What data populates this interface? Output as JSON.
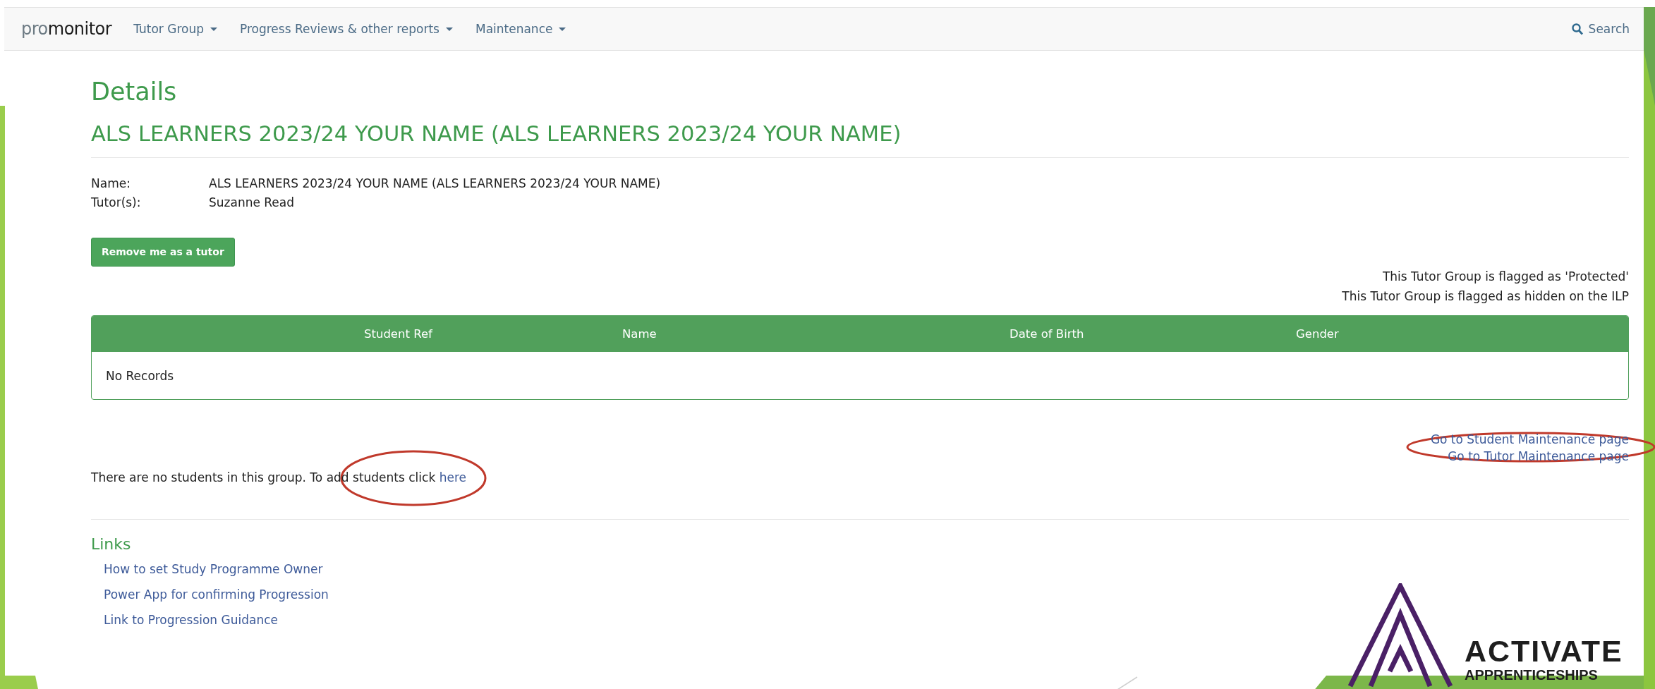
{
  "nav": {
    "brand": [
      "pro",
      "monitor"
    ],
    "menus": [
      "Tutor Group",
      "Progress Reviews & other reports",
      "Maintenance"
    ],
    "search": "Search"
  },
  "page": {
    "title": "Details",
    "subtitle": "ALS LEARNERS 2023/24 YOUR NAME (ALS LEARNERS 2023/24 YOUR NAME)",
    "fields": [
      {
        "label": "Name:",
        "value": "ALS LEARNERS 2023/24 YOUR NAME (ALS LEARNERS 2023/24 YOUR NAME)"
      },
      {
        "label": "Tutor(s):",
        "value": "Suzanne Read"
      }
    ],
    "action_button": "Remove me as a tutor",
    "flags": [
      "This Tutor Group is flagged as 'Protected'",
      "This Tutor Group is flagged as hidden on the ILP"
    ]
  },
  "table": {
    "columns": [
      "Student Ref",
      "Name",
      "Date of Birth",
      "Gender"
    ],
    "empty_message": "No Records"
  },
  "maintenance_links": [
    "Go to Student Maintenance page",
    "Go to Tutor Maintenance page"
  ],
  "notice": {
    "text": "There are no students in this group. To add students click",
    "link": "here"
  },
  "links": {
    "title": "Links",
    "items": [
      "How to set Study Programme Owner",
      "Power App for confirming Progression",
      "Link to Progression Guidance"
    ]
  },
  "logo": {
    "name": "ACTIVATE",
    "tagline": "APPRENTICESHIPS"
  }
}
